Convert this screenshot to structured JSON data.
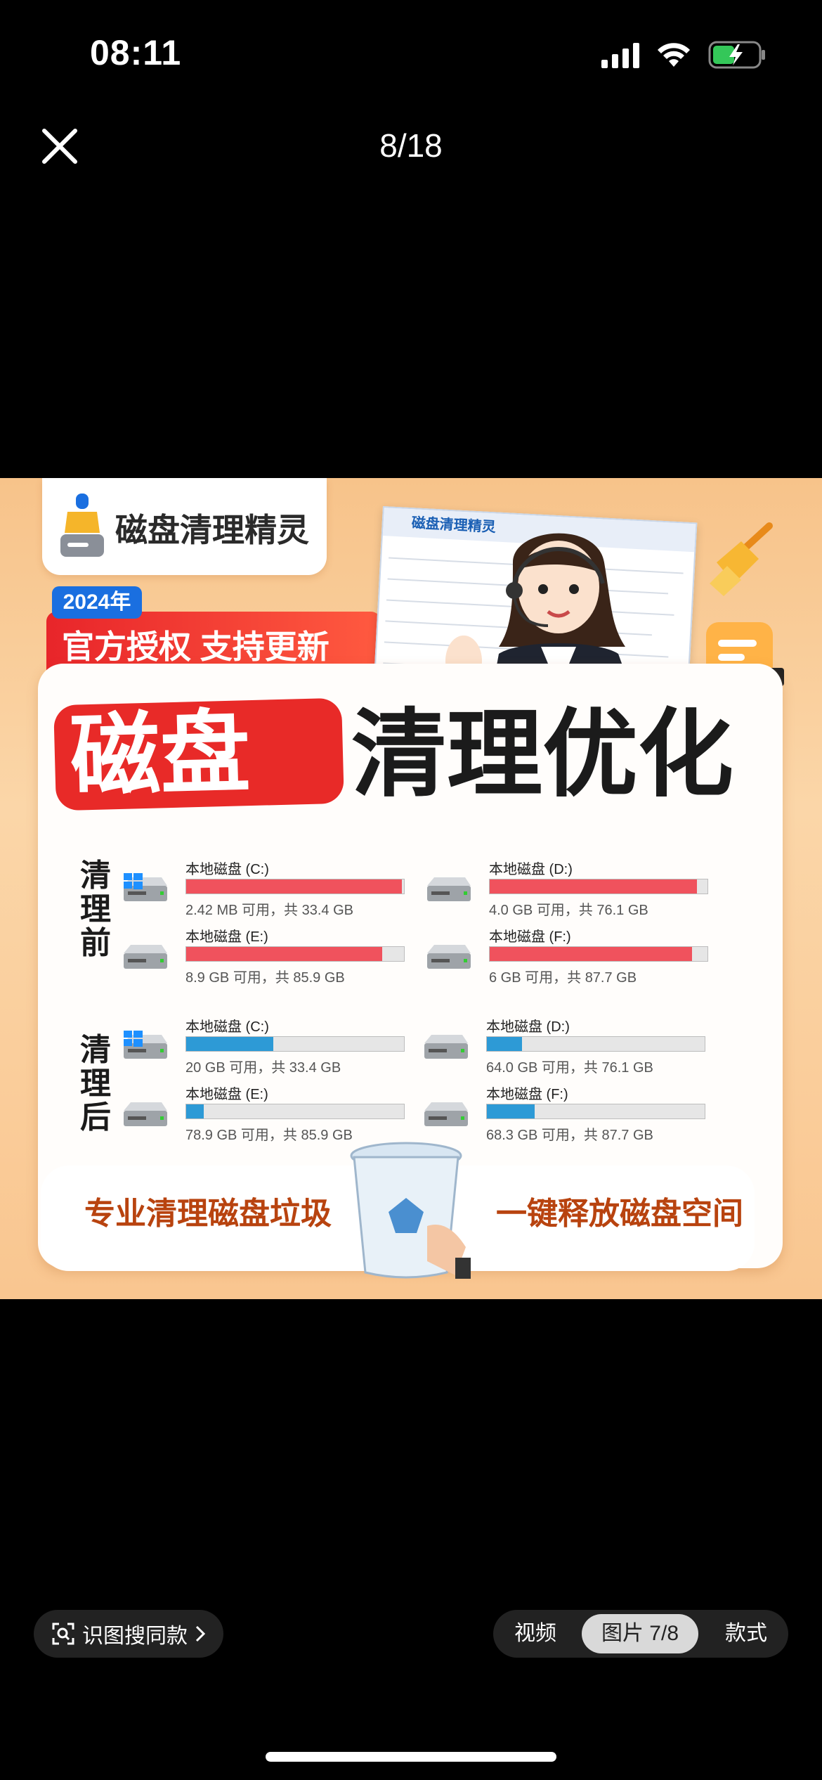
{
  "status_bar": {
    "time": "08:11"
  },
  "top_bar": {
    "counter": "8/18"
  },
  "poster": {
    "logo_text": "磁盘清理精灵",
    "year_badge": "2024年",
    "ribbon_text": "官方授权 支持更新",
    "window_title": "磁盘清理精灵",
    "headline_highlight": "磁盘",
    "headline_rest": "清理优化",
    "before_label": [
      "清",
      "理",
      "前"
    ],
    "after_label": [
      "清",
      "理",
      "后"
    ],
    "before_disks": [
      {
        "name": "本地磁盘 (C:)",
        "free": "2.42 MB 可用，共 33.4 GB",
        "used_fraction": 0.99,
        "windows": true
      },
      {
        "name": "本地磁盘 (D:)",
        "free": "4.0 GB 可用，共 76.1 GB",
        "used_fraction": 0.95,
        "windows": false
      },
      {
        "name": "本地磁盘 (E:)",
        "free": "8.9 GB 可用，共 85.9 GB",
        "used_fraction": 0.9,
        "windows": false
      },
      {
        "name": "本地磁盘 (F:)",
        "free": "6 GB 可用，共 87.7 GB",
        "used_fraction": 0.93,
        "windows": false
      }
    ],
    "after_disks": [
      {
        "name": "本地磁盘 (C:)",
        "free": "20 GB 可用，共 33.4 GB",
        "used_fraction": 0.4,
        "windows": true
      },
      {
        "name": "本地磁盘 (D:)",
        "free": "64.0 GB 可用，共 76.1 GB",
        "used_fraction": 0.16,
        "windows": false
      },
      {
        "name": "本地磁盘 (E:)",
        "free": "78.9 GB 可用，共 85.9 GB",
        "used_fraction": 0.08,
        "windows": false
      },
      {
        "name": "本地磁盘 (F:)",
        "free": "68.3 GB 可用，共 87.7 GB",
        "used_fraction": 0.22,
        "windows": false
      }
    ],
    "bottom_left": "专业清理磁盘垃圾",
    "bottom_right": "一键释放磁盘空间",
    "colors": {
      "before_fill": "#f0525d",
      "after_fill": "#2d9ad6"
    }
  },
  "bottom_controls": {
    "image_search": "识图搜同款",
    "tabs": [
      "视频",
      "图片 7/8",
      "款式"
    ],
    "active_tab": "图片 7/8"
  }
}
